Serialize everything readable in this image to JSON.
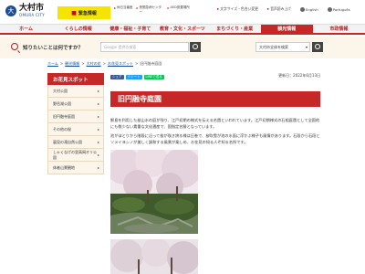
{
  "header": {
    "logo_mark": "大",
    "logo_name": "大村市",
    "logo_sub": "OMURA CITY",
    "emergency_label": "緊急情報",
    "links": [
      "休日当番医",
      "夜間急病センター",
      "AED設置場所"
    ],
    "accessibility": [
      "文字サイズ・色合い変更",
      "音声読み上げ",
      "English",
      "Português"
    ]
  },
  "nav": {
    "items": [
      {
        "label": "ホーム",
        "active": false
      },
      {
        "label": "くらしの情報",
        "active": false
      },
      {
        "label": "健康・福祉・子育て",
        "active": false
      },
      {
        "label": "教育・文化・スポーツ",
        "active": false
      },
      {
        "label": "まちづくり・産業",
        "active": false
      },
      {
        "label": "観光情報",
        "active": true
      },
      {
        "label": "市政情報",
        "active": false
      }
    ]
  },
  "search": {
    "label": "知りたいことは何ですか？",
    "placeholder": "Google 提供の検索",
    "scope": "大村市全体を検索"
  },
  "breadcrumb": [
    "ホーム",
    "観光情報",
    "大村の花",
    "お花見スポット",
    "旧円融寺庭園"
  ],
  "sidebar": {
    "heading": "お花見スポット",
    "items": [
      "大村公園",
      "野岳湖公園",
      "旧円融寺庭園",
      "その他の桜",
      "裏見の滝自然公園",
      "しゃくなげの里高岡オリ公園",
      "体者山景観地"
    ]
  },
  "main": {
    "updated": "更新日：2022年6月13日",
    "share": [
      "シェア",
      "ツイート",
      "LINEで送る"
    ],
    "title": "旧円融寺庭園",
    "text1": "鮮島を利用した桜山水の庭が残り、江戸初期の様式を伝える名園といわれています。江戸初期様式の石組庭園として全国的にも数少ない貴重な文化遺産で、国指定名勝となっています。",
    "text2": "池がほとりから階段に沿って桜が咲き誇る様は圧巻で、桜吹雪が池の水面に浮かぶ様子も風情があります。石段から石段とソメイヨシノが美しく調和する風景が楽しめ、お花見の知る人ぞ知る名所です。"
  },
  "colors": {
    "primary": "#c62828",
    "emergency": "#f5e400",
    "sidebar_bg": "#fbf5ea",
    "logo_blue": "#1a4c9c"
  }
}
